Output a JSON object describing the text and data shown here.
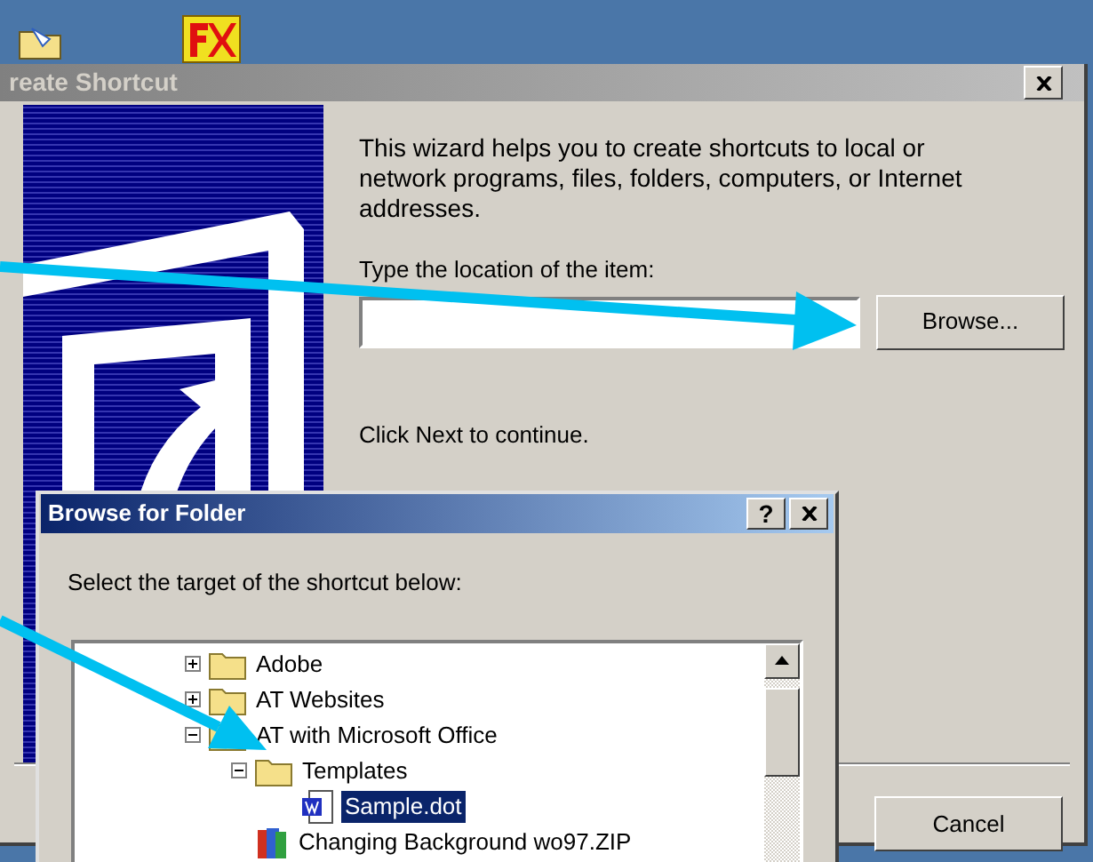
{
  "wizard": {
    "title": "reate Shortcut",
    "intro": "This wizard helps you to create shortcuts to local or network programs, files, folders, computers, or Internet addresses.",
    "location_label": "Type the location of the item:",
    "browse_button": "Browse...",
    "continue_hint": "Click Next to continue.",
    "buttons": [
      "Cancel"
    ]
  },
  "folder_dialog": {
    "title": "Browse for Folder",
    "help_button": "?",
    "prompt": "Select the target of the shortcut below:",
    "tree": [
      {
        "label": "Adobe",
        "kind": "folder",
        "expanded": false,
        "selected": false
      },
      {
        "label": "AT Websites",
        "kind": "folder",
        "expanded": false,
        "selected": false
      },
      {
        "label": "AT with Microsoft Office",
        "kind": "folder",
        "expanded": true,
        "selected": false,
        "children": [
          {
            "label": "Templates",
            "kind": "folder",
            "expanded": true,
            "selected": false,
            "children": [
              {
                "label": "Sample.dot",
                "kind": "document",
                "selected": true
              }
            ]
          },
          {
            "label": "Changing Background wo97.ZIP",
            "kind": "archive",
            "selected": false
          }
        ]
      }
    ]
  }
}
